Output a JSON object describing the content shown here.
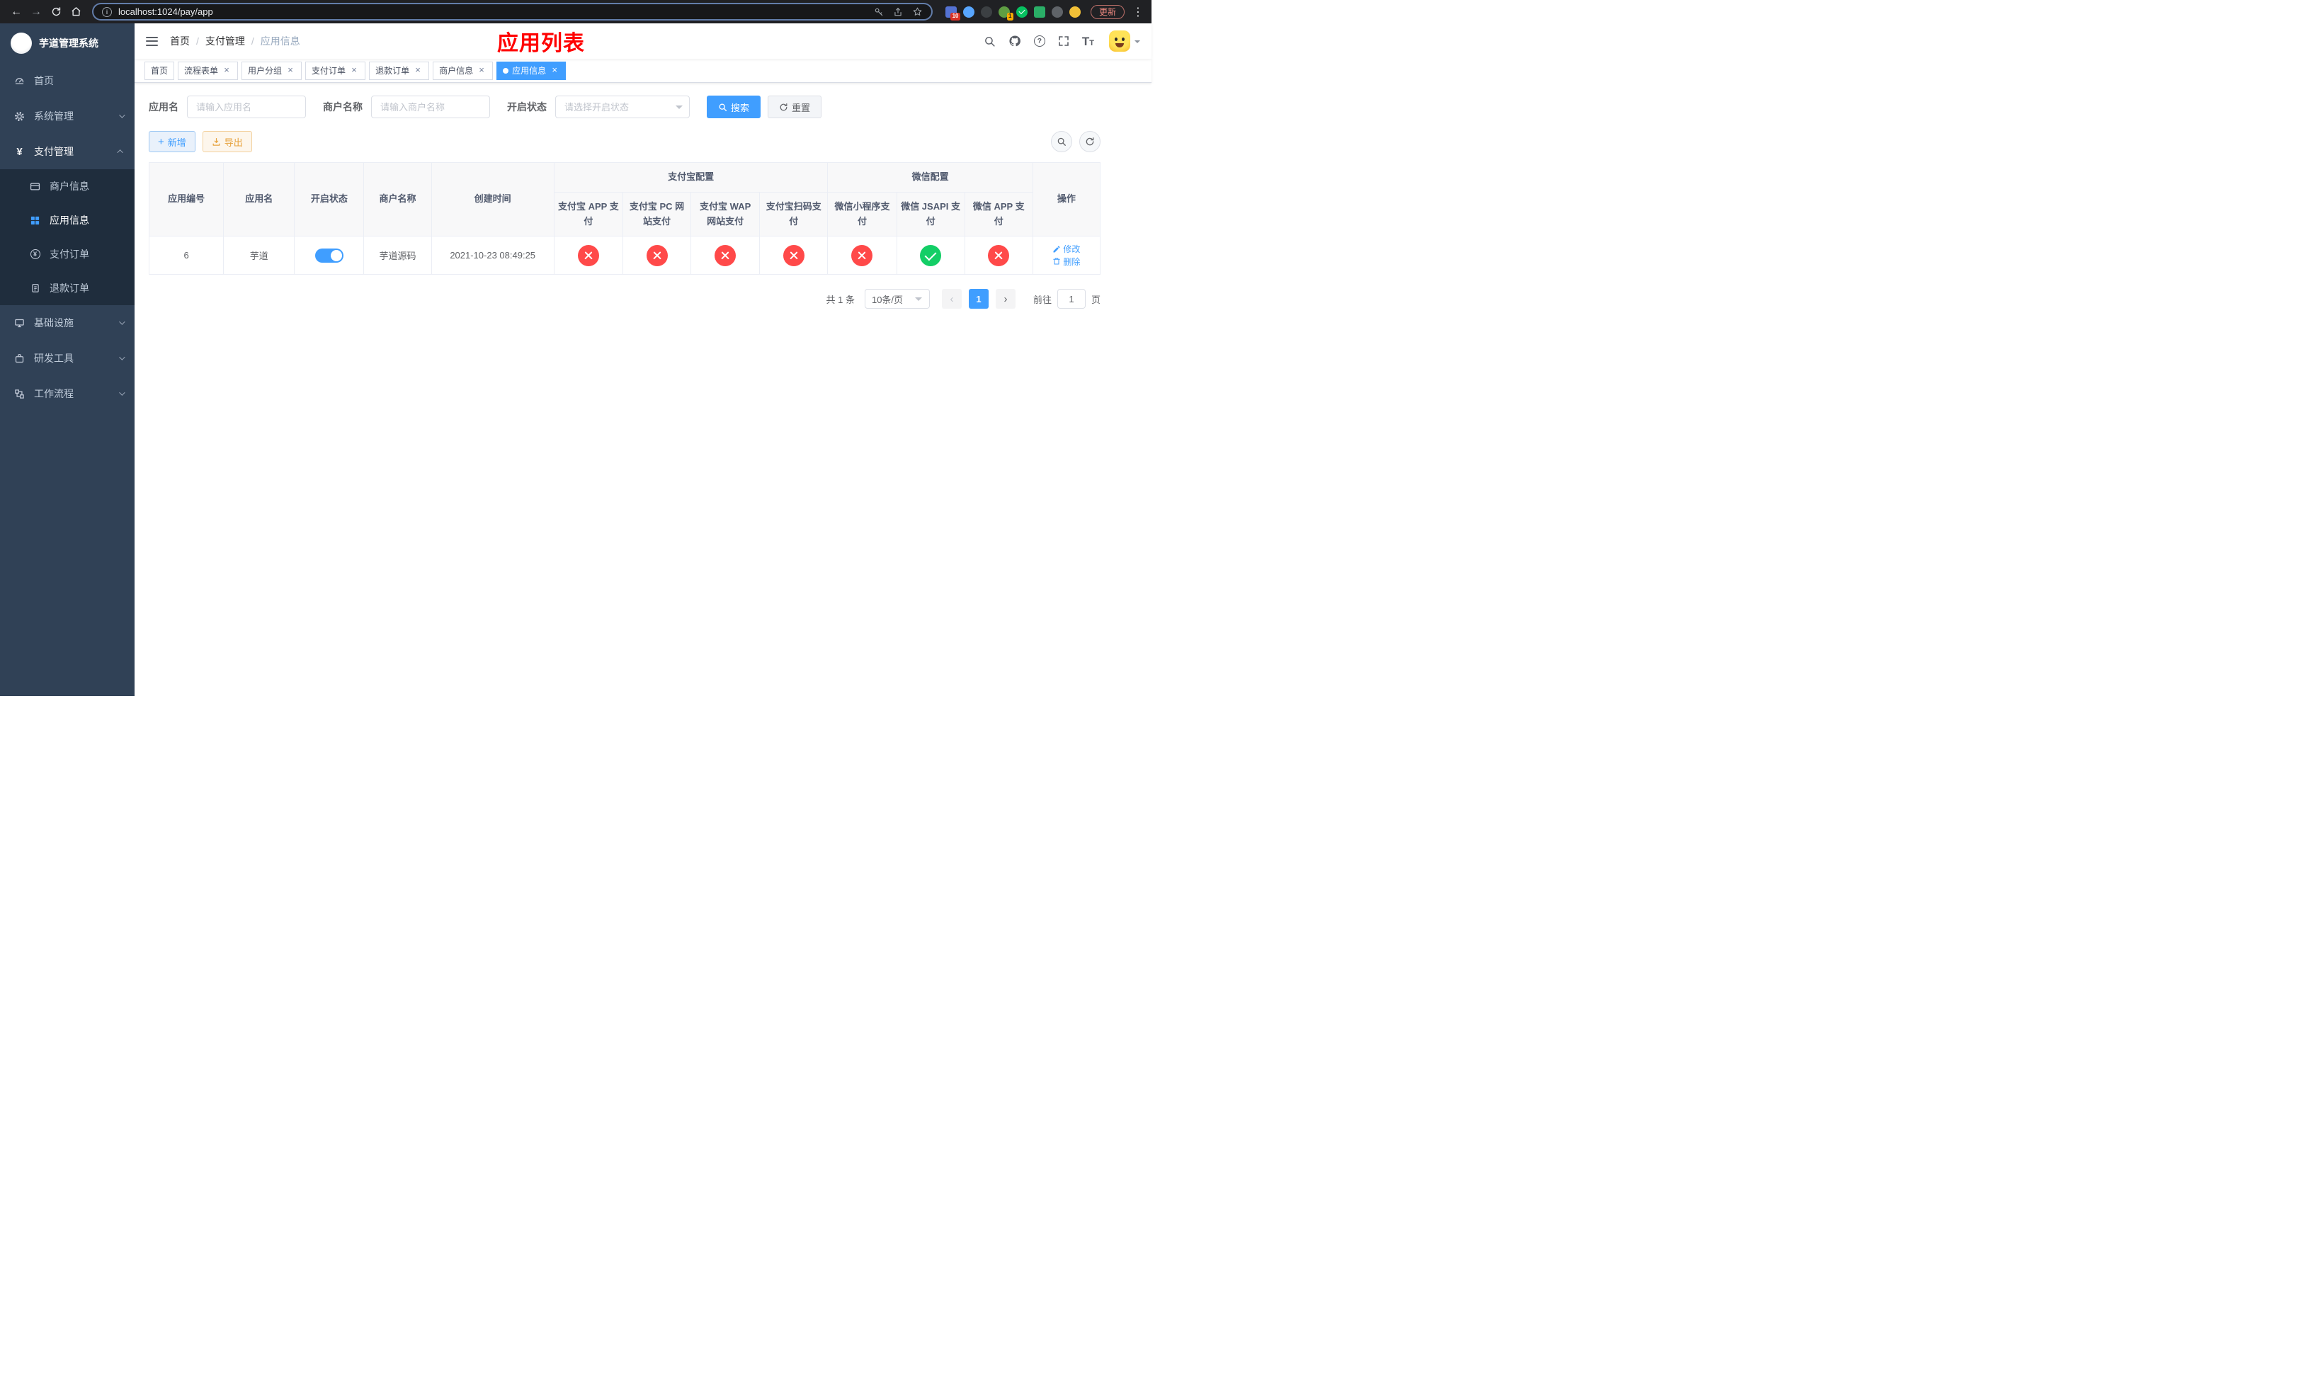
{
  "browser": {
    "url": "localhost:1024/pay/app",
    "update_label": "更新",
    "extensions_badge": "10",
    "profile_badge": "1"
  },
  "sidebar": {
    "title": "芋道管理系统",
    "items": [
      {
        "label": "首页"
      },
      {
        "label": "系统管理"
      },
      {
        "label": "支付管理",
        "children": [
          {
            "label": "商户信息"
          },
          {
            "label": "应用信息"
          },
          {
            "label": "支付订单"
          },
          {
            "label": "退款订单"
          }
        ]
      },
      {
        "label": "基础设施"
      },
      {
        "label": "研发工具"
      },
      {
        "label": "工作流程"
      }
    ]
  },
  "header": {
    "breadcrumb": [
      "首页",
      "支付管理",
      "应用信息"
    ],
    "overlay_title": "应用列表"
  },
  "tabs": [
    {
      "label": "首页",
      "closable": false,
      "active": false
    },
    {
      "label": "流程表单",
      "closable": true,
      "active": false
    },
    {
      "label": "用户分组",
      "closable": true,
      "active": false
    },
    {
      "label": "支付订单",
      "closable": true,
      "active": false
    },
    {
      "label": "退款订单",
      "closable": true,
      "active": false
    },
    {
      "label": "商户信息",
      "closable": true,
      "active": false
    },
    {
      "label": "应用信息",
      "closable": true,
      "active": true
    }
  ],
  "filters": {
    "app_name_label": "应用名",
    "app_name_placeholder": "请输入应用名",
    "merchant_label": "商户名称",
    "merchant_placeholder": "请输入商户名称",
    "status_label": "开启状态",
    "status_placeholder": "请选择开启状态",
    "search_button": "搜索",
    "reset_button": "重置"
  },
  "toolbar": {
    "add_button": "新增",
    "export_button": "导出"
  },
  "table": {
    "group_alipay": "支付宝配置",
    "group_wechat": "微信配置",
    "columns": [
      "应用编号",
      "应用名",
      "开启状态",
      "商户名称",
      "创建时间",
      "支付宝 APP 支付",
      "支付宝 PC 网站支付",
      "支付宝 WAP 网站支付",
      "支付宝扫码支付",
      "微信小程序支付",
      "微信 JSAPI 支付",
      "微信 APP 支付",
      "操作"
    ],
    "rows": [
      {
        "id": "6",
        "name": "芋道",
        "status": true,
        "merchant": "芋道源码",
        "created_at": "2021-10-23 08:49:25",
        "channels": [
          false,
          false,
          false,
          false,
          false,
          true,
          false
        ],
        "edit_label": "修改",
        "delete_label": "删除"
      }
    ]
  },
  "pagination": {
    "total_label": "共 1 条",
    "page_size_label": "10条/页",
    "current_page": "1",
    "goto_prefix": "前往",
    "goto_value": "1",
    "goto_suffix": "页"
  },
  "icons": {
    "back": "←",
    "forward": "→",
    "kebab": "⋮",
    "close": "×",
    "plus": "+",
    "info": "i",
    "question": "?",
    "font_size": "T",
    "yen": "¥",
    "slash": "/",
    "prev": "‹",
    "next": "›"
  },
  "colors": {
    "primary": "#409EFF",
    "success": "#13ce66",
    "danger": "#ff4949",
    "annotation": "#ff0000"
  }
}
